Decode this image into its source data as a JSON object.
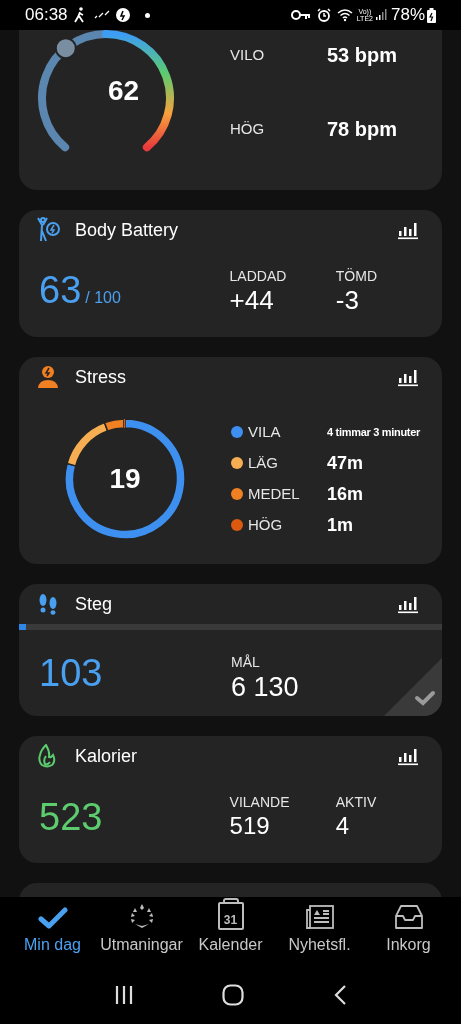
{
  "status_bar": {
    "time": "06:38",
    "volte": "Vo))",
    "network": "LTE2",
    "battery": "78%"
  },
  "heart_rate": {
    "value": "62",
    "stats": [
      {
        "label": "VILO",
        "value": "53 bpm"
      },
      {
        "label": "HÖG",
        "value": "78 bpm"
      }
    ]
  },
  "body_battery": {
    "title": "Body Battery",
    "value": "63",
    "max": "/ 100",
    "stats": [
      {
        "label": "LADDAD",
        "value": "+44"
      },
      {
        "label": "TÖMD",
        "value": "-3"
      }
    ]
  },
  "stress": {
    "title": "Stress",
    "value": "19",
    "legend": [
      {
        "value": "4 timmar 3 minuter",
        "color": "#3d8ff0"
      },
      {
        "value": "47m",
        "color": "#f7ae52"
      },
      {
        "value": "16m",
        "color": "#f08021"
      },
      {
        "value": "1m",
        "color": "#db5a10"
      }
    ],
    "chart_data": {
      "type": "donut",
      "categories": [
        "VILA",
        "LÄG",
        "MEDEL",
        "HÖG"
      ],
      "values": [
        79.15,
        15.31,
        5.21,
        0.33
      ]
    }
  },
  "steps": {
    "title": "Steg",
    "level": 0.017,
    "value": "103",
    "goal_label": "MÅL",
    "goal": "6 130",
    "goal_reached": false
  },
  "calories": {
    "title": "Kalorier",
    "value": "523",
    "stats": [
      {
        "label": "VILANDE",
        "value": "519"
      },
      {
        "label": "AKTIV",
        "value": "4"
      }
    ]
  },
  "bottom_nav": [
    {
      "label": "Min dag",
      "selected": true
    },
    {
      "label": "Utmaningar",
      "selected": false
    },
    {
      "label": "Kalender",
      "icon_text": "31",
      "selected": false
    },
    {
      "label": "Nyhetsfl.",
      "selected": false
    },
    {
      "label": "Inkorg",
      "selected": false
    }
  ]
}
